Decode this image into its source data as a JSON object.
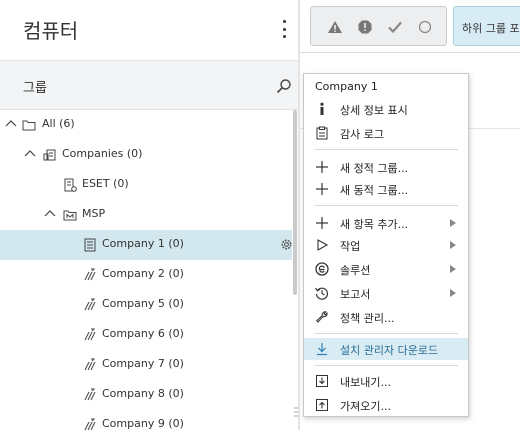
{
  "panel": {
    "title": "컴퓨터",
    "group_label": "그룹"
  },
  "tree": [
    {
      "label": "All (6)"
    },
    {
      "label": "Companies (0)"
    },
    {
      "label": "ESET (0)"
    },
    {
      "label": "MSP"
    },
    {
      "label": "Company 1 (0)"
    },
    {
      "label": "Company 2 (0)"
    },
    {
      "label": "Company 5 (0)"
    },
    {
      "label": "Company 6 (0)"
    },
    {
      "label": "Company 7 (0)"
    },
    {
      "label": "Company 8 (0)"
    },
    {
      "label": "Company 9 (0)"
    }
  ],
  "toolbar": {
    "subgroup_label": "하위 그룹 포함"
  },
  "menu": {
    "header": "Company 1",
    "items": [
      {
        "label": "상세 정보 표시"
      },
      {
        "label": "감사 로그"
      },
      {
        "label": "새 정적 그룹..."
      },
      {
        "label": "새 동적 그룹..."
      },
      {
        "label": "새 항목 추가..."
      },
      {
        "label": "작업"
      },
      {
        "label": "솔루션"
      },
      {
        "label": "보고서"
      },
      {
        "label": "정책 관리..."
      },
      {
        "label": "설치 관리자 다운로드"
      },
      {
        "label": "내보내기..."
      },
      {
        "label": "가져오기..."
      }
    ]
  },
  "colors": {
    "selected_row": "#d3e7ef",
    "highlight_item": "#d9ebf3",
    "accent_icon": "#2a7db5"
  }
}
